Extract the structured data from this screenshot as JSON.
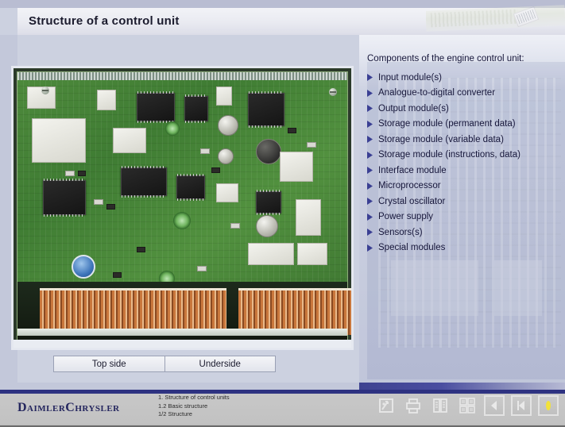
{
  "header": {
    "title": "Structure of a control unit",
    "decor_icon": "circuit-board-photo"
  },
  "main": {
    "photo_alt": "engine control unit circuit board top side",
    "buttons": [
      {
        "label": "Top side",
        "name": "top-side-button"
      },
      {
        "label": "Underside",
        "name": "underside-button"
      }
    ]
  },
  "panel": {
    "heading": "Components of the engine control unit:",
    "items": [
      "Input module(s)",
      "Analogue-to-digital converter",
      "Output module(s)",
      "Storage module (permanent data)",
      "Storage module (variable data)",
      "Storage module (instructions, data)",
      "Interface module",
      "Microprocessor",
      "Crystal oscillator",
      "Power supply",
      "Sensors(s)",
      "Special modules"
    ]
  },
  "footer": {
    "logo": "DaimlerChrysler",
    "breadcrumbs": [
      "1. Structure of control units",
      "1.2 Basic structure",
      "1/2 Structure"
    ],
    "nav": [
      {
        "name": "exit-icon",
        "title": "Exit"
      },
      {
        "name": "print-icon",
        "title": "Print"
      },
      {
        "name": "book-index-icon",
        "title": "Contents"
      },
      {
        "name": "overview-grid-icon",
        "title": "Overview"
      },
      {
        "name": "previous-page-icon",
        "title": "Previous"
      },
      {
        "name": "first-page-icon",
        "title": "First page"
      },
      {
        "name": "next-page-icon",
        "title": "Next"
      }
    ]
  },
  "colors": {
    "brand_blue": "#2f3382",
    "panel_text": "#16163a",
    "bullet": "#3a3f93",
    "highlight": "#f2e23a"
  }
}
